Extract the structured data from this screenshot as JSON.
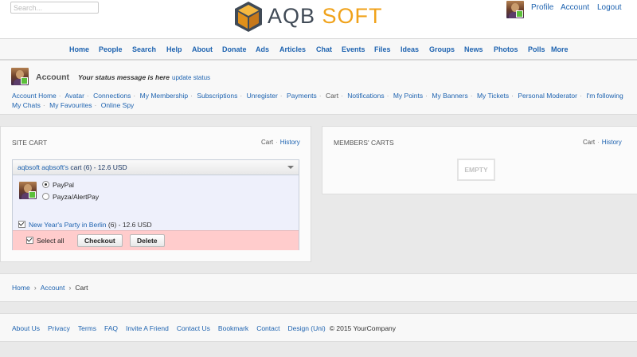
{
  "header": {
    "search_placeholder": "Search...",
    "logo_left": "AQB",
    "logo_right": "SOFT",
    "logo_colors": {
      "dark": "#404a56",
      "accent": "#f0a21a"
    },
    "links": {
      "profile": "Profile",
      "account": "Account",
      "logout": "Logout"
    }
  },
  "nav": {
    "items": [
      "Home",
      "People",
      "Search",
      "Help",
      "About",
      "Donate",
      "Ads",
      "Articles",
      "Chat",
      "Events",
      "Files",
      "Ideas",
      "Groups",
      "News",
      "Photos",
      "Polls",
      "More"
    ]
  },
  "account": {
    "title": "Account",
    "status_message": "Your status message is here",
    "update_status": "update status",
    "links": [
      "Account Home",
      "Avatar",
      "Connections",
      "My Membership",
      "Subscriptions",
      "Unregister",
      "Payments",
      "Cart",
      "Notifications",
      "My Points",
      "My Banners",
      "My Tickets",
      "Personal Moderator",
      "I'm following",
      "My Chats",
      "My Favourites",
      "Online Spy"
    ],
    "current": "Cart"
  },
  "site_cart": {
    "title": "SITE CART",
    "tab_cart": "Cart",
    "tab_history": "History",
    "vendor_link": "aqbsoft aqbsoft's",
    "vendor_rest": " cart (6) - 12.6 USD",
    "payment_options": [
      "PayPal",
      "Payza/AlertPay"
    ],
    "selected_payment": "PayPal",
    "item_name": "New Year's Party in Berlin",
    "item_rest": " (6) - 12.6 USD",
    "select_all": "Select all",
    "checkout": "Checkout",
    "delete": "Delete"
  },
  "members_carts": {
    "title": "MEMBERS' CARTS",
    "tab_cart": "Cart",
    "tab_history": "History",
    "empty": "EMPTY"
  },
  "breadcrumb": {
    "items": [
      "Home",
      "Account",
      "Cart"
    ],
    "separator": "›"
  },
  "footer": {
    "links": [
      "About Us",
      "Privacy",
      "Terms",
      "FAQ",
      "Invite A Friend",
      "Contact Us",
      "Bookmark",
      "Contact",
      "Design (Uni)"
    ],
    "copyright": "© 2015 YourCompany"
  },
  "icons": {
    "logo": "cube-logo-icon",
    "avatar": "user-avatar",
    "online": "online-status-icon",
    "dropdown": "chevron-down-icon"
  }
}
